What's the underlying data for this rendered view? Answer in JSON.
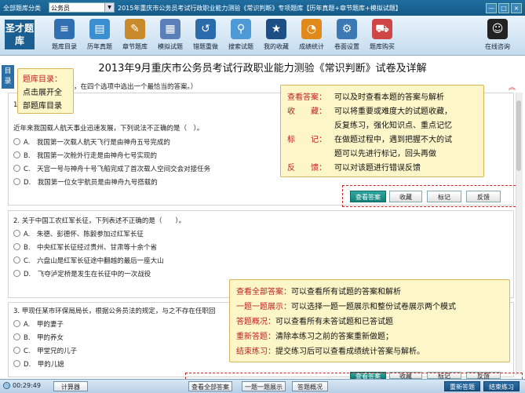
{
  "topbar": {
    "category_label": "全部题库分类",
    "category_value": "公务员",
    "exam_title": "2015年重庆市公务员考试行政职业能力测验《常识判断》专项题库【历年真题+章节题库+模拟试题】",
    "window_controls": [
      "—",
      "□",
      "×"
    ]
  },
  "toolbar": {
    "logo_text": "圣才题库",
    "items": [
      {
        "label": "题库目录",
        "icon": "catalog-icon",
        "color": "#2f6fb2",
        "glyph": "≡"
      },
      {
        "label": "历年真题",
        "icon": "past-papers-icon",
        "color": "#3a8fd1",
        "glyph": "▤"
      },
      {
        "label": "章节题库",
        "icon": "chapter-icon",
        "color": "#c98a2b",
        "glyph": "✎"
      },
      {
        "label": "模拟试题",
        "icon": "mock-exam-icon",
        "color": "#5b7fb9",
        "glyph": "▦"
      },
      {
        "label": "错题重做",
        "icon": "redo-icon",
        "color": "#2a6cab",
        "glyph": "↺"
      },
      {
        "label": "搜索试题",
        "icon": "search-icon",
        "color": "#4e9ad6",
        "glyph": "⚲"
      },
      {
        "label": "我的收藏",
        "icon": "favorite-icon",
        "color": "#1d4f86",
        "glyph": "★"
      },
      {
        "label": "成绩统计",
        "icon": "statistics-icon",
        "color": "#e08a1c",
        "glyph": "◔"
      },
      {
        "label": "卷面设置",
        "icon": "settings-icon",
        "color": "#3b78b4",
        "glyph": "⚙"
      },
      {
        "label": "题库购买",
        "icon": "cart-icon",
        "color": "#d04545",
        "glyph": "⛟"
      },
      {
        "label": "在线咨询",
        "icon": "qq-icon",
        "color": "#222222",
        "glyph": "☺"
      }
    ]
  },
  "page_title": "2013年9月重庆市公务员考试行政职业能力测验《常识判断》试卷及详解",
  "sidebar_tab": "目录",
  "instruction": "题目要求，在四个选项中选出一个最恰当的答案。）",
  "questions": [
    {
      "number": "1",
      "text": "近年来我国载人航天事业迅速发展，下列说法不正确的是（　）。",
      "options": [
        "A.　我国第一次载人航天飞行是由神舟五号完成的",
        "B.　我国第一次舱外行走是由神舟七号实现的",
        "C.　天宫一号与神舟十号飞船完成了首次载人空间交会对接任务",
        "D.　我国第一位女宇航员是由神舟九号搭载的"
      ]
    },
    {
      "number": "2",
      "text": "2. 关于中国工农红军长征，下列表述不正确的是（　　）。",
      "options": [
        "A.　朱德、彭德怀、陈毅参加过红军长征",
        "B.　中央红军长征经过贵州、甘肃等十余个省",
        "C.　六盘山是红军长征途中翻越的最后一座大山",
        "D.　飞夺泸定桥是发生在长征中的一次战役"
      ]
    },
    {
      "number": "3",
      "text": "3. 甲现任某市环保局局长，根据公务员法的规定，与之不存在任职回",
      "options": [
        "A.　甲的妻子",
        "B.　甲的养女",
        "C.　甲堂兄的儿子",
        "D.　甲的儿媳"
      ]
    }
  ],
  "answer_buttons": [
    "查看答案",
    "收藏",
    "标记",
    "反馈"
  ],
  "callout_catalog": [
    "题库目录：",
    "点击展开全",
    "部题库目录"
  ],
  "callout_actions": [
    {
      "key": "查看答案：",
      "desc": "可以及时查看本题的答案与解析"
    },
    {
      "key": "收　　藏：",
      "desc": "可以将重要或难度大的试题收藏，"
    },
    {
      "key": "",
      "desc": "反复练习，强化知识点、重点记忆"
    },
    {
      "key": "标　　记：",
      "desc": "在做题过程中，遇到把握不大的试"
    },
    {
      "key": "",
      "desc": "题可以先进行标记，回头再做"
    },
    {
      "key": "反　　馈：",
      "desc": "可以对该题进行错误反馈"
    }
  ],
  "callout_footer": [
    {
      "key": "查看全部答案：",
      "desc": "可以查看所有试题的答案和解析"
    },
    {
      "key": "一题一题展示：",
      "desc": "可以选择一题一题展示和整份试卷展示两个模式"
    },
    {
      "key": "答题概况：",
      "desc": "可以查看所有未答试题和已答试题"
    },
    {
      "key": "重新答题：",
      "desc": "清除本练习之前的答案重新做题；"
    },
    {
      "key": "结束练习：",
      "desc": "提交练习后可以查看成绩统计答案与解析。"
    }
  ],
  "partial_buttons": [
    "查看答案",
    "收藏",
    "标记",
    "反馈"
  ],
  "footer": {
    "timer": "00:29:49",
    "calculator": "计算器",
    "view_all": "查看全部答案",
    "one_by_one": "一题一题展示",
    "overview": "答题概况",
    "restart": "重新答题",
    "finish": "结束练习"
  },
  "colors": {
    "accent": "#1b5f92",
    "highlight_red": "#c02020",
    "callout_bg": "#fdf6c8"
  }
}
